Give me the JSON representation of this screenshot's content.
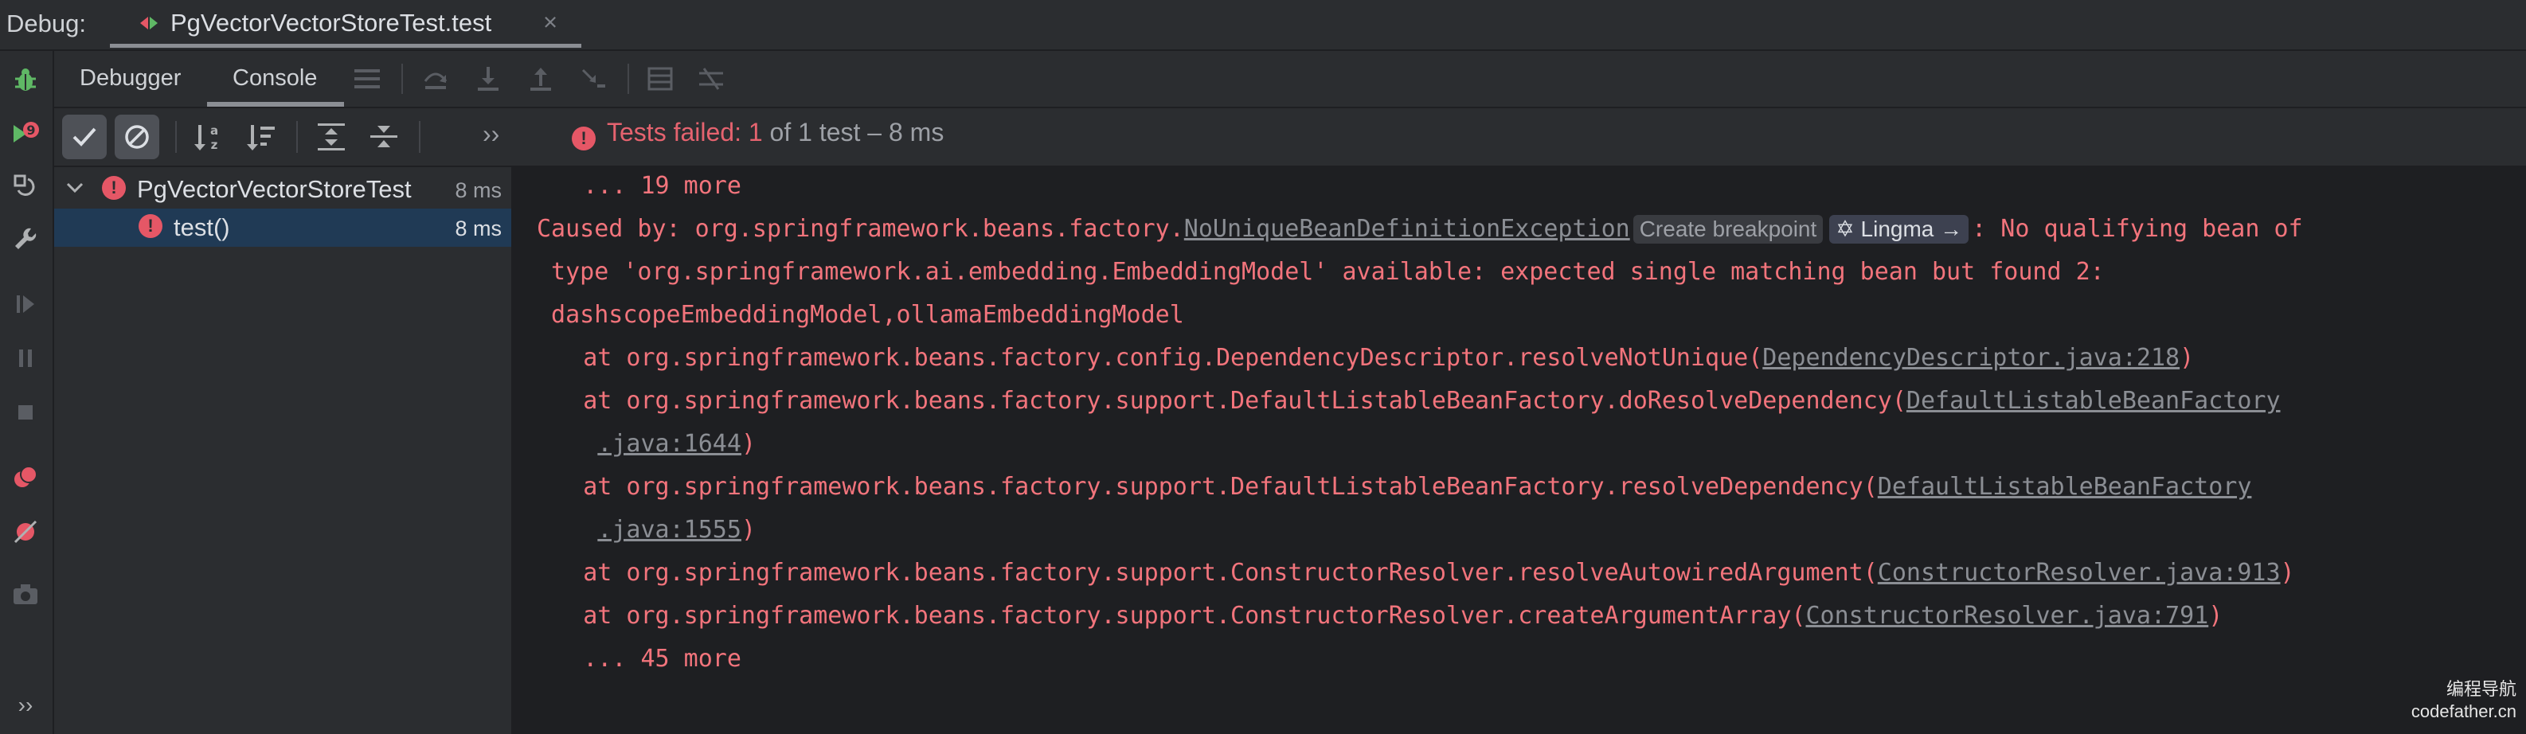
{
  "debug_bar": {
    "label": "Debug:",
    "tab_title": "PgVectorVectorStoreTest.test",
    "close_glyph": "×"
  },
  "panel_tabs": {
    "debugger": "Debugger",
    "console": "Console"
  },
  "test_toolbar": {
    "overflow": "››",
    "status_prefix": "Tests failed:",
    "status_count": "1",
    "status_suffix": "of 1 test – 8 ms"
  },
  "tree": {
    "root": {
      "label": "PgVectorVectorStoreTest",
      "time": "8 ms"
    },
    "child": {
      "label": "test()",
      "time": "8 ms"
    }
  },
  "console": {
    "line1": "    ... 19 more",
    "caused_prefix": "Caused by: org.springframework.beans.factory.",
    "caused_exception": "NoUniqueBeanDefinitionException",
    "inlay_breakpoint": "Create breakpoint",
    "inlay_lingma": "Lingma →",
    "caused_suffix": ": No qualifying bean of",
    "line3": " type 'org.springframework.ai.embedding.EmbeddingModel' available: expected single matching bean but found 2:",
    "line4": " dashscopeEmbeddingModel,ollamaEmbeddingModel",
    "frames": [
      {
        "prefix": "    at org.springframework.beans.factory.config.DependencyDescriptor.resolveNotUnique(",
        "link": "DependencyDescriptor.java:218",
        "suffix": ")"
      },
      {
        "prefix": "    at org.springframework.beans.factory.support.DefaultListableBeanFactory.doResolveDependency(",
        "link": "DefaultListableBeanFactory",
        "suffix": ""
      },
      {
        "prefix": "     ",
        "link": ".java:1644",
        "suffix": ")"
      },
      {
        "prefix": "    at org.springframework.beans.factory.support.DefaultListableBeanFactory.resolveDependency(",
        "link": "DefaultListableBeanFactory",
        "suffix": ""
      },
      {
        "prefix": "     ",
        "link": ".java:1555",
        "suffix": ")"
      },
      {
        "prefix": "    at org.springframework.beans.factory.support.ConstructorResolver.resolveAutowiredArgument(",
        "link": "ConstructorResolver.java:913",
        "suffix": ")"
      },
      {
        "prefix": "    at org.springframework.beans.factory.support.ConstructorResolver.createArgumentArray(",
        "link": "ConstructorResolver.java:791",
        "suffix": ")"
      }
    ],
    "last_line": "    ... 45 more"
  },
  "watermark": {
    "line1": "编程导航",
    "line2": "codefather.cn"
  },
  "colors": {
    "error_text": "#f2747c",
    "link": "#8b8e94",
    "selection": "#203a55",
    "error_badge": "#e55766"
  }
}
